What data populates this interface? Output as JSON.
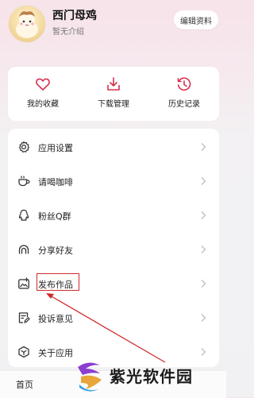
{
  "profile": {
    "name": "西门母鸡",
    "bio": "暂无介绍",
    "edit_label": "编辑资料"
  },
  "quick_actions": [
    {
      "label": "我的收藏",
      "icon": "heart-icon"
    },
    {
      "label": "下载管理",
      "icon": "download-icon"
    },
    {
      "label": "历史记录",
      "icon": "history-icon"
    }
  ],
  "menu": [
    {
      "label": "应用设置",
      "icon": "gear-icon"
    },
    {
      "label": "请喝咖啡",
      "icon": "coffee-icon"
    },
    {
      "label": "粉丝Q群",
      "icon": "qq-icon"
    },
    {
      "label": "分享好友",
      "icon": "share-icon"
    },
    {
      "label": "发布作品",
      "icon": "publish-image-icon"
    },
    {
      "label": "投诉意见",
      "icon": "complaint-icon"
    },
    {
      "label": "关于应用",
      "icon": "about-icon"
    }
  ],
  "tabbar": {
    "home_label": "首页"
  },
  "watermark": {
    "text": "紫光软件园"
  },
  "colors": {
    "accent": "#d6314f",
    "annotation": "#d12a2a"
  }
}
